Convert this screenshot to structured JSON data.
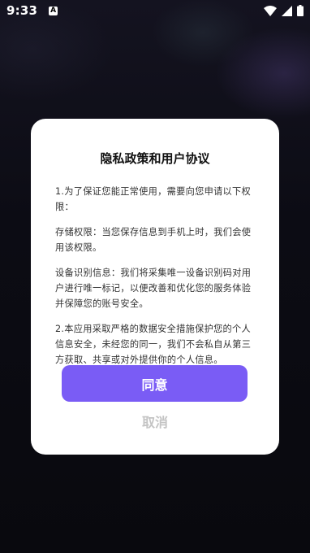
{
  "status_bar": {
    "time": "9:33",
    "notification_icon": "A",
    "icons": [
      "wifi-icon",
      "signal-icon",
      "battery-icon"
    ]
  },
  "dialog": {
    "title": "隐私政策和用户协议",
    "paragraphs": [
      "1.为了保证您能正常使用，需要向您申请以下权限：",
      "存储权限：当您保存信息到手机上时，我们会使用该权限。",
      "设备识别信息：我们将采集唯一设备识别码对用户进行唯一标记，以便改善和优化您的服务体验并保障您的账号安全。",
      "2.本应用采取严格的数据安全措施保护您的个人信息安全，未经您的同一，我们不会私自从第三方获取、共享或对外提供你的个人信息。"
    ],
    "agree_label": "同意",
    "cancel_label": "取消"
  },
  "colors": {
    "accent": "#7a5cf5",
    "cancel_text": "#c4c4c4",
    "background": "#0b0b10",
    "dialog_bg": "#ffffff"
  }
}
